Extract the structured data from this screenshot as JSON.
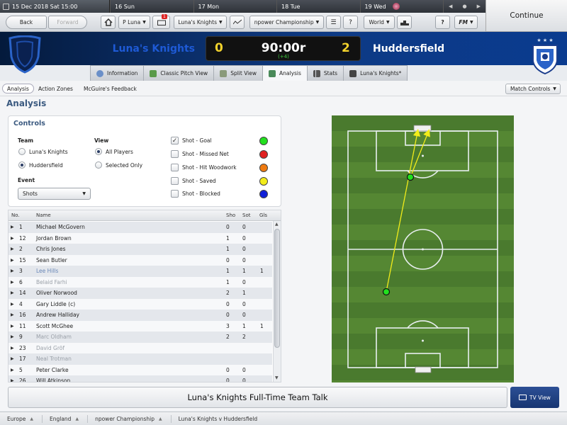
{
  "colors": {
    "header_bg": "#0b2f6b",
    "home_team": "#1e5ad6",
    "score": "#f2d22c",
    "added_time": "#3ecb3e",
    "title": "#3b5a80",
    "shot_goal": "#22e01e",
    "shot_missed": "#e02020",
    "shot_woodwork": "#ef7a10",
    "shot_saved": "#f2ec1a",
    "shot_blocked": "#1020d8"
  },
  "topbar": {
    "current_date": "15 Dec 2018 Sat 15:00",
    "days": [
      {
        "label": "16 Sun"
      },
      {
        "label": "17 Mon"
      },
      {
        "label": "18 Tue"
      },
      {
        "label": "19 Wed"
      }
    ],
    "continue_label": "Continue"
  },
  "nav": {
    "back_label": "Back",
    "forward_label": "Forward",
    "manager_label": "P Luna",
    "inbox_badge": "1",
    "club_label": "Luna's Knights",
    "competition_label": "npower Championship",
    "world_label": "World",
    "help_label": "?",
    "fm_label": "FM"
  },
  "match": {
    "home_team": "Luna's Knights",
    "away_team": "Huddersfield",
    "home_score": "0",
    "away_score": "2",
    "time": "90:00r",
    "added_time": "(+4)"
  },
  "tabs": [
    {
      "label": "Information",
      "icon": "info-icon"
    },
    {
      "label": "Classic Pitch View",
      "icon": "pitch-icon"
    },
    {
      "label": "Split View",
      "icon": "split-view-icon"
    },
    {
      "label": "Analysis",
      "icon": "analysis-icon",
      "active": true
    },
    {
      "label": "Stats",
      "icon": "stats-icon"
    },
    {
      "label": "Luna's Knights*",
      "icon": "team-icon"
    }
  ],
  "subtabs": {
    "analysis": "Analysis",
    "action_zones": "Action Zones",
    "feedback": "McGuire's Feedback",
    "match_controls": "Match Controls"
  },
  "page_title": "Analysis",
  "controls": {
    "title": "Controls",
    "team_label": "Team",
    "team_options": [
      "Luna's Knights",
      "Huddersfield"
    ],
    "team_selected": "Huddersfield",
    "view_label": "View",
    "view_options": [
      "All Players",
      "Selected Only"
    ],
    "view_selected": "All Players",
    "event_label": "Event",
    "event_value": "Shots",
    "shot_types": [
      {
        "label": "Shot - Goal",
        "checked": true,
        "color": "#22e01e"
      },
      {
        "label": "Shot - Missed Net",
        "checked": false,
        "color": "#e02020"
      },
      {
        "label": "Shot - Hit Woodwork",
        "checked": false,
        "color": "#ef7a10"
      },
      {
        "label": "Shot - Saved",
        "checked": false,
        "color": "#f2ec1a"
      },
      {
        "label": "Shot - Blocked",
        "checked": false,
        "color": "#1020d8"
      }
    ]
  },
  "table": {
    "headers": {
      "no": "No.",
      "name": "Name",
      "sho": "Sho",
      "sot": "Sot",
      "gls": "Gls"
    },
    "rows": [
      {
        "no": "1",
        "name": "Michael McGovern",
        "sho": "0",
        "sot": "0",
        "gls": "",
        "style": ""
      },
      {
        "no": "12",
        "name": "Jordan Brown",
        "sho": "1",
        "sot": "0",
        "gls": "",
        "style": ""
      },
      {
        "no": "2",
        "name": "Chris Jones",
        "sho": "1",
        "sot": "0",
        "gls": "",
        "style": ""
      },
      {
        "no": "15",
        "name": "Sean Butler",
        "sho": "0",
        "sot": "0",
        "gls": "",
        "style": ""
      },
      {
        "no": "3",
        "name": "Lee Hills",
        "sho": "1",
        "sot": "1",
        "gls": "1",
        "style": "link"
      },
      {
        "no": "6",
        "name": "Belaid Farhi",
        "sho": "1",
        "sot": "0",
        "gls": "",
        "style": "dim"
      },
      {
        "no": "14",
        "name": "Oliver Norwood",
        "sho": "2",
        "sot": "1",
        "gls": "",
        "style": ""
      },
      {
        "no": "4",
        "name": "Gary Liddle (c)",
        "sho": "0",
        "sot": "0",
        "gls": "",
        "style": ""
      },
      {
        "no": "16",
        "name": "Andrew Halliday",
        "sho": "0",
        "sot": "0",
        "gls": "",
        "style": ""
      },
      {
        "no": "11",
        "name": "Scott McGhee",
        "sho": "3",
        "sot": "1",
        "gls": "1",
        "style": ""
      },
      {
        "no": "9",
        "name": "Marc Oldham",
        "sho": "2",
        "sot": "2",
        "gls": "",
        "style": "dim"
      },
      {
        "no": "23",
        "name": "David Gröf",
        "sho": "",
        "sot": "",
        "gls": "",
        "style": "dim"
      },
      {
        "no": "17",
        "name": "Neal Trotman",
        "sho": "",
        "sot": "",
        "gls": "",
        "style": "dim"
      },
      {
        "no": "5",
        "name": "Peter Clarke",
        "sho": "0",
        "sot": "0",
        "gls": "",
        "style": ""
      },
      {
        "no": "26",
        "name": "Will Atkinson",
        "sho": "0",
        "sot": "0",
        "gls": "",
        "style": ""
      }
    ]
  },
  "footer": {
    "team_talk_label": "Luna's Knights Full-Time Team Talk",
    "tv_view_label": "TV View",
    "breadcrumbs": [
      "Europe",
      "England",
      "npower Championship",
      "Luna's Knights v Huddersfield"
    ]
  }
}
